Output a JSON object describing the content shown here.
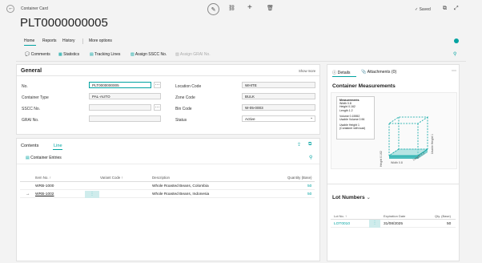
{
  "window": {
    "caption": "Container Card",
    "title": "PLT0000000005",
    "saved_label": "Saved"
  },
  "nav_tabs": [
    "Home",
    "Reports",
    "History",
    "More options"
  ],
  "actions": [
    "Comments",
    "Statistics",
    "Tracking Lines",
    "Assign SSCC No.",
    "Assign GRAI No."
  ],
  "general": {
    "heading": "General",
    "show_more": "Show more",
    "fields_left": [
      {
        "label": "No.",
        "value": "PLT0000000005"
      },
      {
        "label": "Container Type",
        "value": "PAL-AUTO"
      },
      {
        "label": "SSCC No.",
        "value": ""
      },
      {
        "label": "GRAI No.",
        "value": ""
      }
    ],
    "fields_right": [
      {
        "label": "Location Code",
        "value": "WHITE"
      },
      {
        "label": "Zone Code",
        "value": "BULK"
      },
      {
        "label": "Bin Code",
        "value": "W-05-0003"
      },
      {
        "label": "Status",
        "value": "Active"
      }
    ]
  },
  "contents": {
    "tab_contents": "Contents",
    "tab_line": "Line",
    "entries_label": "Container Entries",
    "columns": {
      "item_no": "Item No. ↑",
      "variant": "Variant Code ↑",
      "description": "Description",
      "qty": "Quantity (Base)"
    },
    "rows": [
      {
        "item_no": "WRB-1000",
        "variant": "",
        "description": "Whole Roasted Beans, Colombia",
        "qty": "50"
      },
      {
        "item_no": "WRB-1002",
        "variant": "",
        "description": "Whole Roasted Beans, Indonesia",
        "qty": "50"
      }
    ],
    "arrow": "→"
  },
  "factbox": {
    "tab_details": "Details",
    "tab_attachments": "Attachments (0)",
    "measurements_title": "Container Measurements",
    "tooltip": {
      "title": "Measurements",
      "width": "Width 0.8",
      "height": "Height 0.162",
      "length": "Length 1.2",
      "volume": "Volume 0.15552",
      "usable_volume": "Usable Volume 0.96",
      "usable_height": "Usable Height 1",
      "note": "(Container with load)"
    },
    "axis": {
      "width": "Width 0.8",
      "length": "Length 1.2",
      "height": "Height 0.162",
      "usable_height": "Usable Height 1"
    },
    "lot_title": "Lot Numbers",
    "lot_columns": {
      "lot": "Lot No. ↑",
      "exp": "Expiration Date",
      "qty": "Qty. (Base)"
    },
    "lot_rows": [
      {
        "lot": "LOT0010",
        "exp": "31/08/2025",
        "qty": "50"
      }
    ]
  },
  "colors": {
    "accent": "#00a3a1",
    "background": "#f3f3f3",
    "card": "#ffffff"
  }
}
